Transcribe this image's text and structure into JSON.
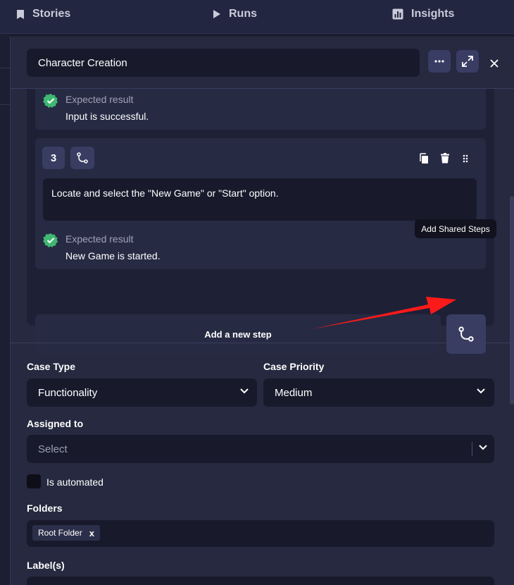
{
  "nav": {
    "items": [
      {
        "label": "Stories",
        "icon": "bookmark-icon"
      },
      {
        "label": "Runs",
        "icon": "play-icon"
      },
      {
        "label": "Insights",
        "icon": "chart-icon"
      }
    ]
  },
  "header": {
    "title": "Character Creation",
    "more_icon": "more-horizontal-icon",
    "expand_icon": "expand-icon",
    "close_icon": "close-icon"
  },
  "steps": {
    "previous_expected_label": "Expected result",
    "previous_expected_value": "Input is successful.",
    "step3": {
      "number": "3",
      "text": "Locate and select the \"New Game\" or \"Start\" option.",
      "expected_label": "Expected result",
      "expected_value": "New Game is started."
    },
    "add_step_label": "Add a new step",
    "tooltip": "Add Shared Steps"
  },
  "form": {
    "case_type": {
      "label": "Case Type",
      "value": "Functionality"
    },
    "case_priority": {
      "label": "Case Priority",
      "value": "Medium"
    },
    "assigned_to": {
      "label": "Assigned to",
      "placeholder": "Select"
    },
    "is_automated": {
      "label": "Is automated",
      "checked": false
    },
    "folders": {
      "label": "Folders",
      "chips": [
        {
          "label": "Root Folder",
          "remove": "x"
        }
      ]
    },
    "labels": {
      "label": "Label(s)"
    }
  },
  "colors": {
    "background": "#1b1d30",
    "panel": "#26293f",
    "input": "#181a2c",
    "accent_button": "#393c63",
    "success": "#3fb872",
    "annotation_arrow": "#ff1a1a"
  }
}
